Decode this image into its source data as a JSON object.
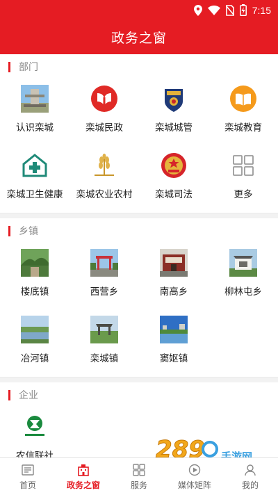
{
  "status": {
    "time": "7:15"
  },
  "header": {
    "title": "政务之窗"
  },
  "sections": [
    {
      "title": "部门",
      "items": [
        {
          "label": "认识栾城",
          "icon": "city-gate-photo"
        },
        {
          "label": "栾城民政",
          "icon": "civil-affairs-emblem"
        },
        {
          "label": "栾城城管",
          "icon": "city-management-badge"
        },
        {
          "label": "栾城教育",
          "icon": "book-icon"
        },
        {
          "label": "栾城卫生健康",
          "icon": "health-icon"
        },
        {
          "label": "栾城农业农村",
          "icon": "wheat-icon"
        },
        {
          "label": "栾城司法",
          "icon": "justice-emblem"
        },
        {
          "label": "更多",
          "icon": "grid-icon"
        }
      ]
    },
    {
      "title": "乡镇",
      "items": [
        {
          "label": "楼底镇",
          "icon": "town-photo"
        },
        {
          "label": "西营乡",
          "icon": "town-photo"
        },
        {
          "label": "南高乡",
          "icon": "town-photo"
        },
        {
          "label": "柳林屯乡",
          "icon": "town-photo"
        },
        {
          "label": "冶河镇",
          "icon": "town-photo"
        },
        {
          "label": "栾城镇",
          "icon": "town-photo"
        },
        {
          "label": "窦妪镇",
          "icon": "town-photo"
        }
      ]
    },
    {
      "title": "企业",
      "items": [
        {
          "label": "农信联社",
          "icon": "rural-credit-logo"
        }
      ]
    }
  ],
  "tabs": [
    {
      "label": "首页",
      "icon": "newspaper-icon",
      "active": false
    },
    {
      "label": "政务之窗",
      "icon": "building-icon",
      "active": true
    },
    {
      "label": "服务",
      "icon": "grid-icon",
      "active": false
    },
    {
      "label": "媒体矩阵",
      "icon": "media-icon",
      "active": false
    },
    {
      "label": "我的",
      "icon": "user-icon",
      "active": false
    }
  ],
  "watermark": {
    "text": "手游网",
    "brand": "289"
  },
  "colors": {
    "accent": "#e51c23",
    "inactive": "#666666",
    "divider": "#f2f2f2"
  }
}
